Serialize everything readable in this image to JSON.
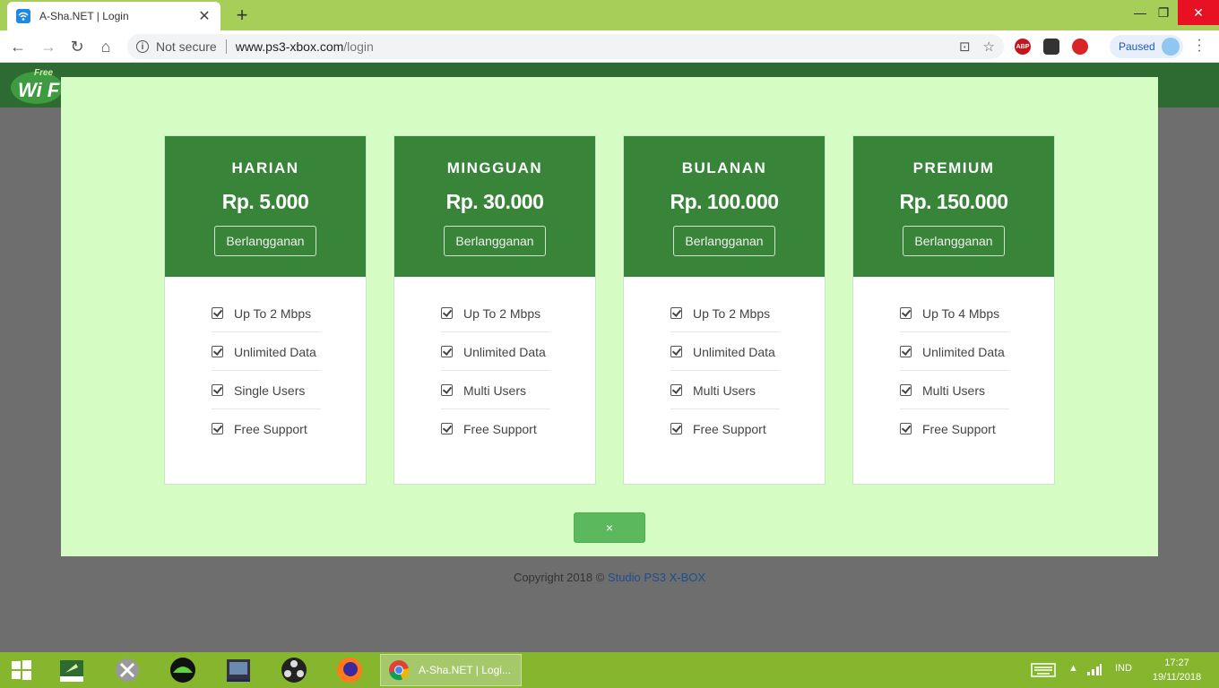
{
  "browser": {
    "tab_title": "A-Sha.NET | Login",
    "security_label": "Not secure",
    "url_host": "www.ps3-xbox.com",
    "url_path": "/login",
    "profile_label": "Paused",
    "ext_abp": "ABP"
  },
  "logo": {
    "free": "Free",
    "wifi": "Wi F"
  },
  "plans": [
    {
      "name": "HARIAN",
      "price": "Rp. 5.000",
      "button": "Berlangganan",
      "features": [
        "Up To 2 Mbps",
        "Unlimited Data",
        "Single Users",
        "Free Support"
      ]
    },
    {
      "name": "MINGGUAN",
      "price": "Rp. 30.000",
      "button": "Berlangganan",
      "features": [
        "Up To 2 Mbps",
        "Unlimited Data",
        "Multi Users",
        "Free Support"
      ]
    },
    {
      "name": "BULANAN",
      "price": "Rp. 100.000",
      "button": "Berlangganan",
      "features": [
        "Up To 2 Mbps",
        "Unlimited Data",
        "Multi Users",
        "Free Support"
      ]
    },
    {
      "name": "PREMIUM",
      "price": "Rp. 150.000",
      "button": "Berlangganan",
      "features": [
        "Up To 4 Mbps",
        "Unlimited Data",
        "Multi Users",
        "Free Support"
      ]
    }
  ],
  "modal": {
    "close_label": "×"
  },
  "footer": {
    "copyright_text": "Copyright 2018 © ",
    "copyright_link": "Studio PS3 X-BOX"
  },
  "taskbar": {
    "active_window": "A-Sha.NET | Logi...",
    "language": "IND",
    "time": "17:27",
    "date": "19/11/2018"
  },
  "colors": {
    "plan_header": "#388439",
    "modal_bg": "#d4fcc3",
    "close_button": "#5cb85c",
    "taskbar": "#86b52e",
    "tabstrip": "#a6ce59"
  }
}
